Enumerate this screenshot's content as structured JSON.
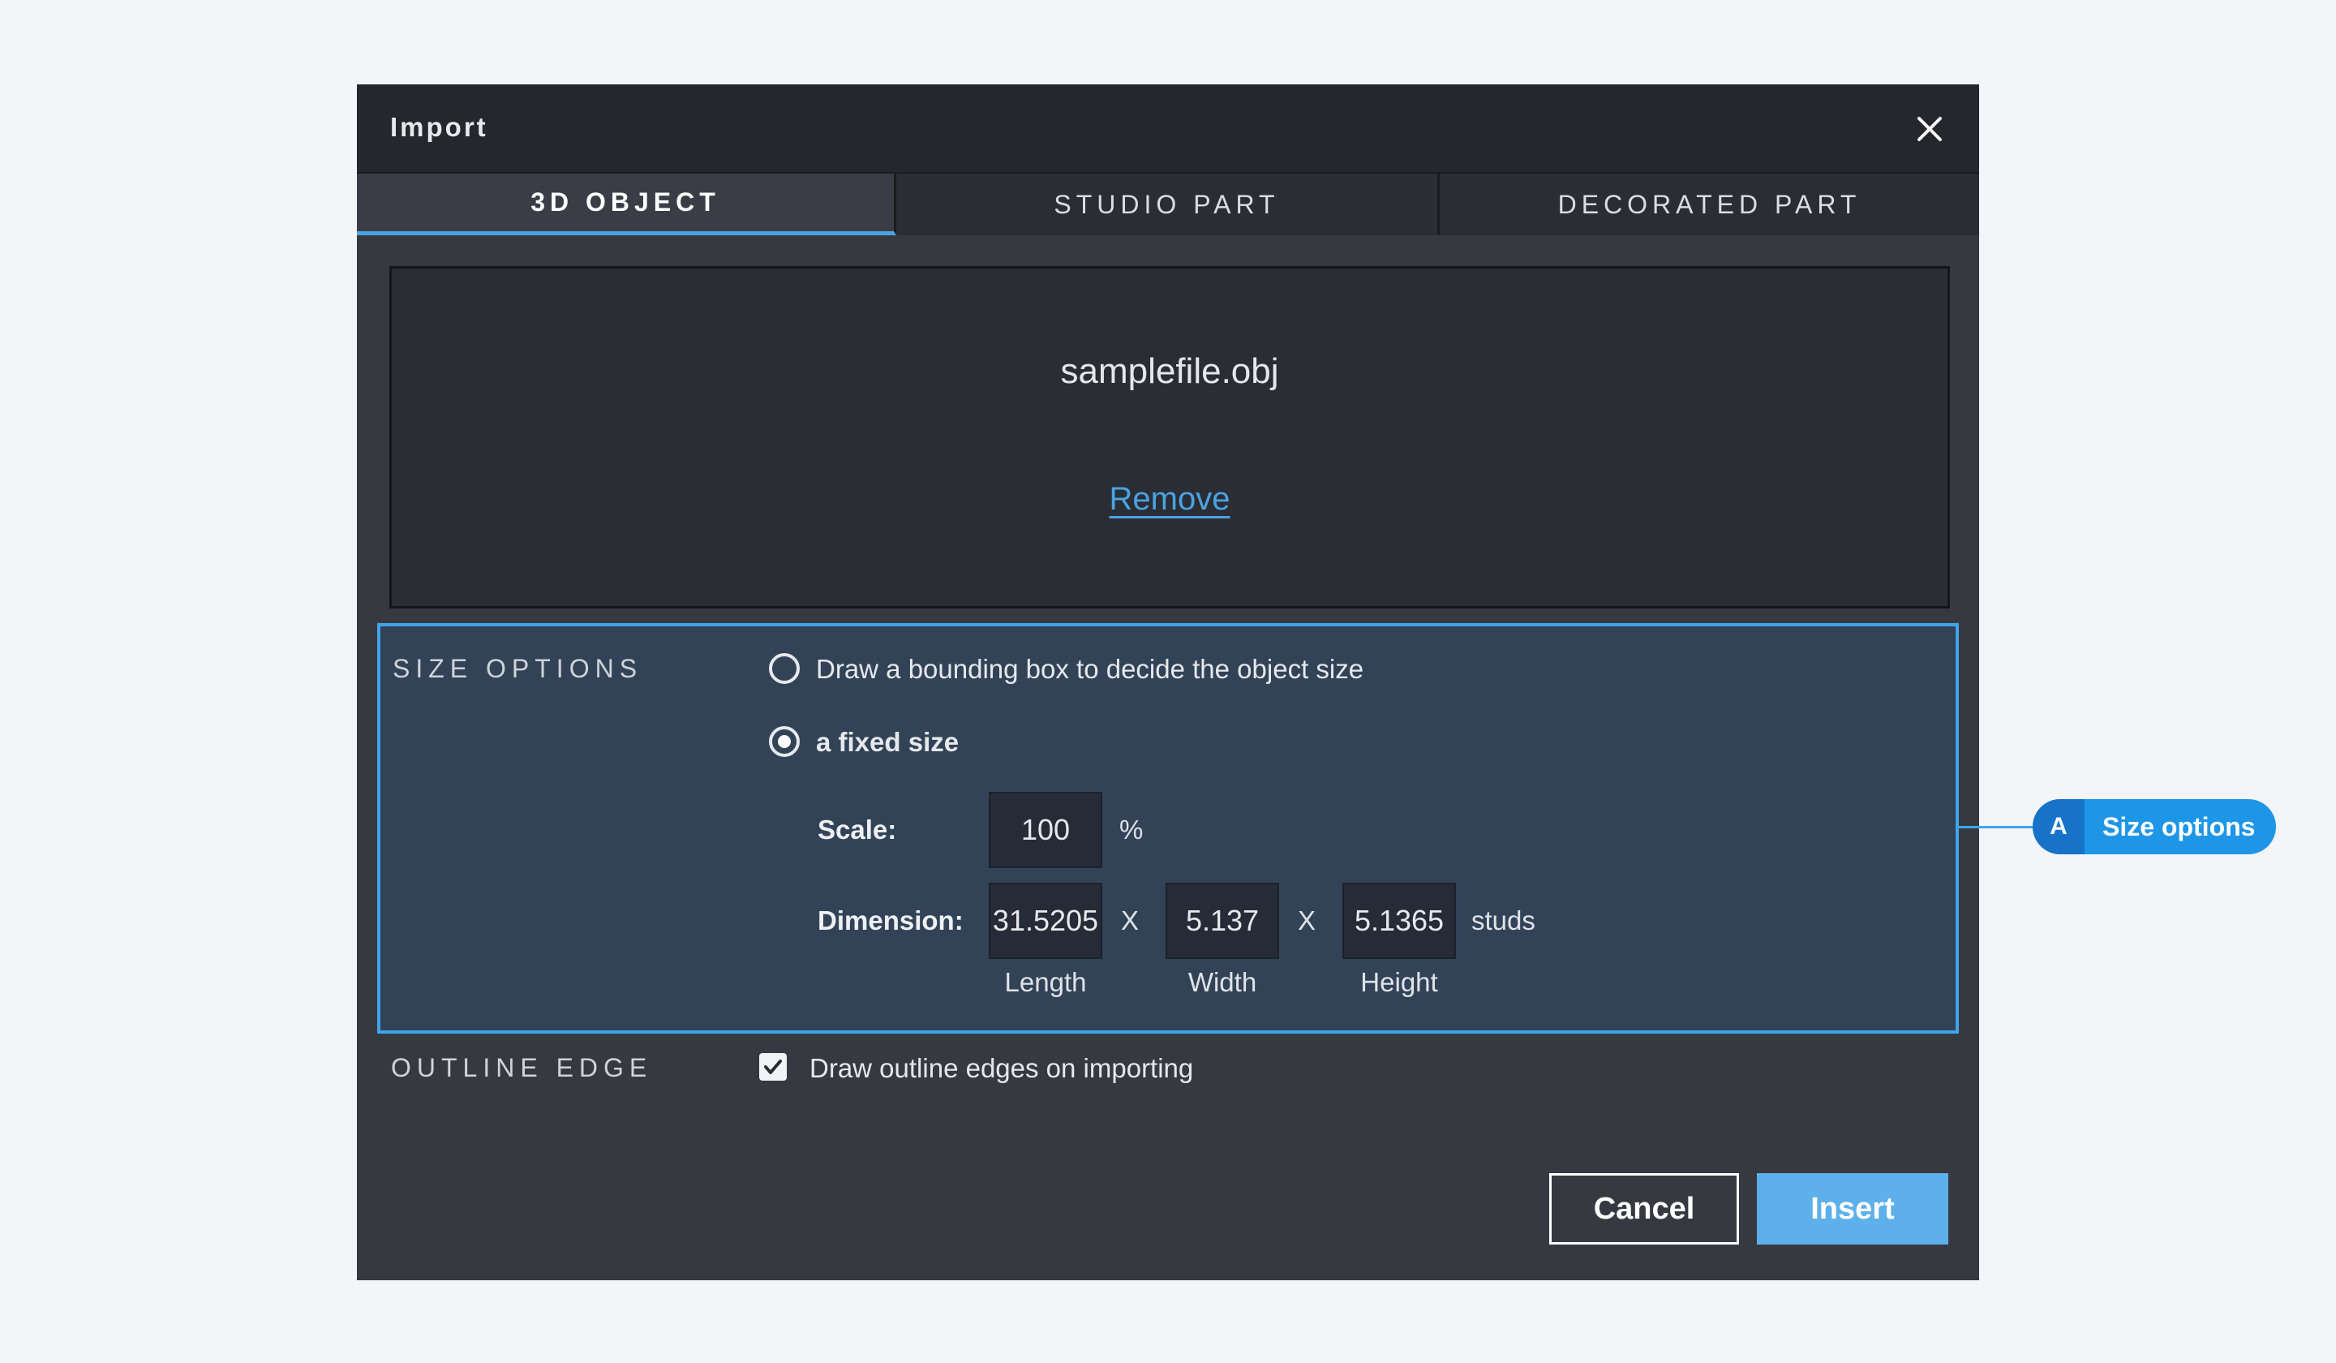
{
  "dialog": {
    "title": "Import",
    "close_icon": "close-icon"
  },
  "tabs": [
    {
      "label": "3D OBJECT",
      "active": true
    },
    {
      "label": "STUDIO PART",
      "active": false
    },
    {
      "label": "DECORATED PART",
      "active": false
    }
  ],
  "file": {
    "name": "samplefile.obj",
    "remove_label": "Remove"
  },
  "size_options": {
    "label": "SIZE OPTIONS",
    "option_bounding_box": "Draw a bounding box to decide the object size",
    "option_fixed": "a fixed size",
    "selected": "a fixed size",
    "scale_label": "Scale:",
    "scale_value": "100",
    "scale_unit": "%",
    "dimension_label": "Dimension:",
    "length_value": "31.5205",
    "width_value": "5.137",
    "height_value": "5.1365",
    "separator": "X",
    "dimension_unit": "studs",
    "length_label": "Length",
    "width_label": "Width",
    "height_label": "Height"
  },
  "outline_edge": {
    "label": "OUTLINE EDGE",
    "checkbox_label": "Draw outline edges on importing",
    "checked": true
  },
  "buttons": {
    "cancel": "Cancel",
    "insert": "Insert"
  },
  "callout": {
    "letter": "A",
    "text": "Size options"
  },
  "colors": {
    "accent": "#4aa3e2",
    "dialog_bg": "#363940",
    "titlebar_bg": "#25272d",
    "size_box_bg": "#324357",
    "insert_button": "#5db0ea",
    "callout_bg": "#1e96e8"
  }
}
